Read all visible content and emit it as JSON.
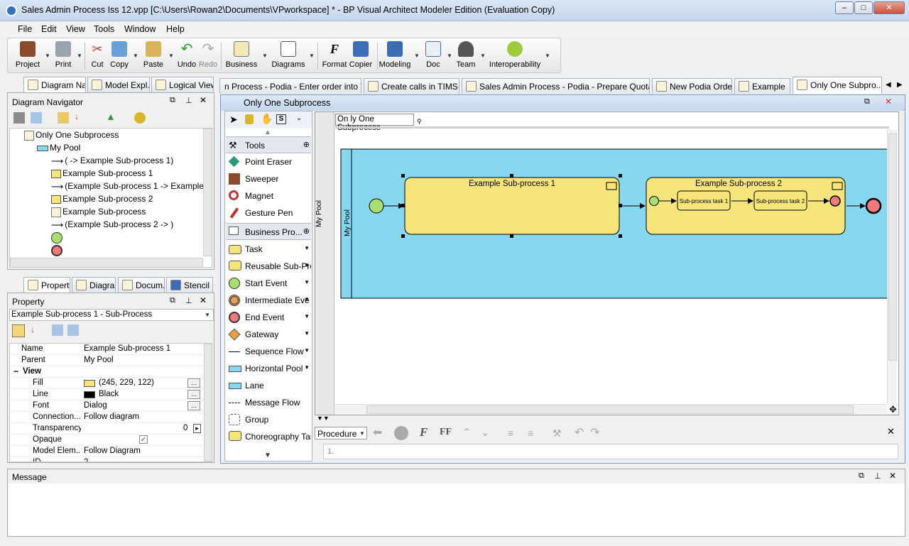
{
  "window": {
    "title": "Sales Admin Process Iss 12.vpp [C:\\Users\\Rowan2\\Documents\\VPworkspace] * - BP Visual Architect Modeler Edition (Evaluation Copy)",
    "min": "–",
    "max": "□",
    "close": "✕"
  },
  "menu": [
    "File",
    "Edit",
    "View",
    "Tools",
    "Window",
    "Help"
  ],
  "toolbar": [
    "Project",
    "Print",
    "Cut",
    "Copy",
    "Paste",
    "Undo",
    "Redo",
    "Business",
    "Diagrams",
    "Format",
    "Copier",
    "Modeling",
    "Doc",
    "Team",
    "Interoperability"
  ],
  "left_tabs": [
    "Diagram Na...",
    "Model Expl...",
    "Logical View"
  ],
  "diagram_navigator": {
    "title": "Diagram Navigator",
    "tree": [
      {
        "label": "Only One Subprocess",
        "indent": 0
      },
      {
        "label": "My Pool",
        "indent": 1
      },
      {
        "label": "( -> Example Sub-process 1)",
        "indent": 2
      },
      {
        "label": "Example Sub-process 1",
        "indent": 2
      },
      {
        "label": "(Example Sub-process 1 -> Example Sub-",
        "indent": 2
      },
      {
        "label": "Example Sub-process 2",
        "indent": 2
      },
      {
        "label": "Example Sub-process",
        "indent": 3
      },
      {
        "label": "(Example Sub-process 2 -> )",
        "indent": 2
      },
      {
        "label": "",
        "indent": 2
      },
      {
        "label": "",
        "indent": 2
      }
    ]
  },
  "lower_tabs": [
    "Property",
    "Diagra...",
    "Docum...",
    "Stencil"
  ],
  "property": {
    "title": "Property",
    "selector": "Example Sub-process 1 - Sub-Process",
    "rows": [
      {
        "name": "Name",
        "value": "Example Sub-process 1"
      },
      {
        "name": "Parent",
        "value": "My Pool"
      },
      {
        "name": "View",
        "value": ""
      },
      {
        "name": "Fill",
        "value": "(245, 229, 122)"
      },
      {
        "name": "Line",
        "value": "Black"
      },
      {
        "name": "Font",
        "value": "Dialog"
      },
      {
        "name": "Connection...",
        "value": "Follow diagram"
      },
      {
        "name": "Transparency",
        "value": "0"
      },
      {
        "name": "Opaque",
        "value": "✓"
      },
      {
        "name": "Model Elem...",
        "value": "Follow Diagram"
      },
      {
        "name": "ID",
        "value": "2"
      }
    ]
  },
  "doc_tabs": [
    "n Process - Podia - Enter order into TIMS",
    "Create calls in TIMS",
    "Sales Admin Process - Podia - Prepare Quotation",
    "New Podia Order",
    "Example",
    "Only One Subpro..."
  ],
  "diagram": {
    "title": "Only One Subprocess",
    "breadcrumb": "On ly One Subprocess",
    "pool": "My Pool",
    "lane": "My Pool",
    "sub1": "Example Sub-process 1",
    "sub2": "Example Sub-process 2",
    "task1": "Sub-process task 1",
    "task2": "Sub-process task 2"
  },
  "palette": {
    "tools_header": "Tools",
    "tools": [
      "Point Eraser",
      "Sweeper",
      "Magnet",
      "Gesture Pen"
    ],
    "business_header": "Business Pro...",
    "business": [
      "Task",
      "Reusable Sub-Pro",
      "Start Event",
      "Intermediate Eve",
      "End Event",
      "Gateway",
      "Sequence Flow",
      "Horizontal Pool",
      "Lane",
      "Message Flow",
      "Group",
      "Choreography Task"
    ]
  },
  "procedure": {
    "dropdown": "Procedure",
    "line": "1."
  },
  "message": {
    "title": "Message"
  },
  "colors": {
    "pool": "#87d7f0",
    "subprocess": "#f5e57a",
    "start": "#a8e070",
    "end": "#f07a7a"
  }
}
